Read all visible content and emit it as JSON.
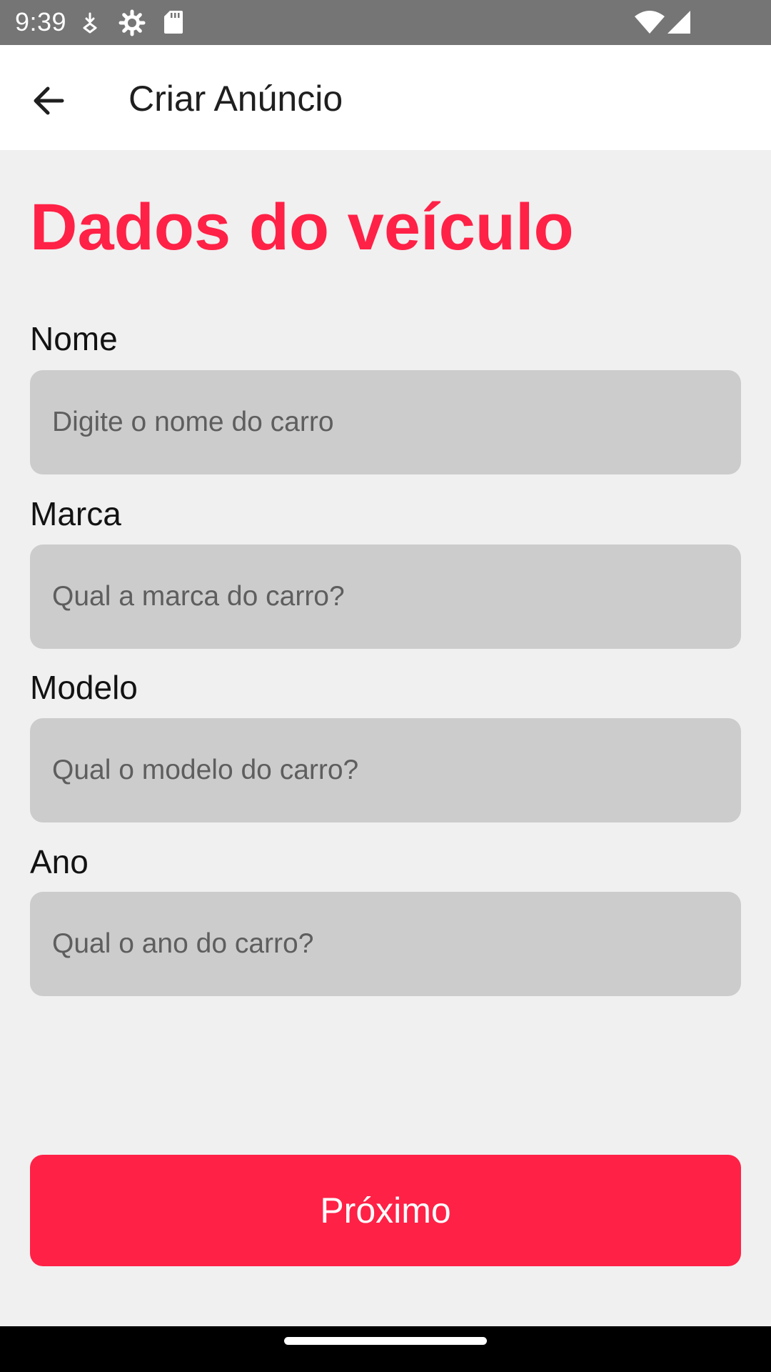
{
  "status_bar": {
    "time": "9:39",
    "icons": [
      "download-icon",
      "settings-gear-icon",
      "sd-card-icon",
      "wifi-icon",
      "cellular-signal-icon"
    ]
  },
  "app_bar": {
    "title": "Criar Anúncio",
    "back_icon": "arrow-back-icon"
  },
  "heading": "Dados do veículo",
  "fields": [
    {
      "label": "Nome",
      "placeholder": "Digite o nome do carro",
      "value": ""
    },
    {
      "label": "Marca",
      "placeholder": "Qual a marca do carro?",
      "value": ""
    },
    {
      "label": "Modelo",
      "placeholder": "Qual o modelo do carro?",
      "value": ""
    },
    {
      "label": "Ano",
      "placeholder": "Qual o ano do carro?",
      "value": ""
    }
  ],
  "next_button": {
    "label": "Próximo"
  },
  "colors": {
    "accent": "#ff2146",
    "status_bar": "#757575",
    "app_bar": "#ffffff",
    "background": "#f0f0f0",
    "input_background": "#cccccc",
    "nav_bar": "#000000"
  }
}
